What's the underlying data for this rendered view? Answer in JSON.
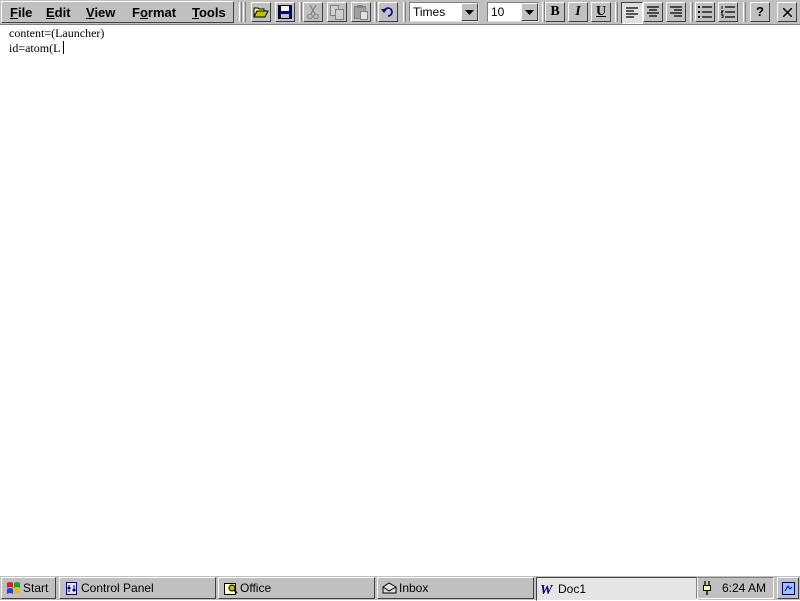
{
  "menu": {
    "file": {
      "pre": "",
      "ul": "F",
      "post": "ile"
    },
    "edit": {
      "pre": "",
      "ul": "E",
      "post": "dit"
    },
    "view": {
      "pre": "",
      "ul": "V",
      "post": "iew"
    },
    "format": {
      "pre": "F",
      "ul": "o",
      "post": "rmat"
    },
    "tools": {
      "pre": "",
      "ul": "T",
      "post": "ools"
    }
  },
  "toolbar": {
    "font_name": "Times",
    "font_size": "10",
    "bold_label": "B",
    "italic_label": "I",
    "underline_label": "U",
    "help_label": "?",
    "alignment_selected": "left",
    "icons": [
      "open-icon",
      "save-icon",
      "cut-icon",
      "copy-icon",
      "paste-icon",
      "undo-icon",
      "align-left-icon",
      "align-center-icon",
      "align-right-icon",
      "bullets-icon",
      "numbering-icon",
      "close-icon"
    ]
  },
  "document": {
    "lines": [
      "content=(Launcher)",
      "id=atom(L"
    ]
  },
  "taskbar": {
    "start_label": "Start",
    "tasks": [
      {
        "label": "Control Panel",
        "icon": "control-panel-icon"
      },
      {
        "label": "Office",
        "icon": "office-icon"
      },
      {
        "label": "Inbox",
        "icon": "inbox-icon"
      },
      {
        "label": "Doc1",
        "icon": "word-icon",
        "active": true
      }
    ],
    "clock": "6:24 AM",
    "desktop_icon": "show-desktop-icon"
  },
  "colors": {
    "face": "#c0c0c0",
    "highlight": "#ffffff",
    "shadow": "#808080",
    "dark_shadow": "#404040",
    "selection_blue": "#000080"
  }
}
